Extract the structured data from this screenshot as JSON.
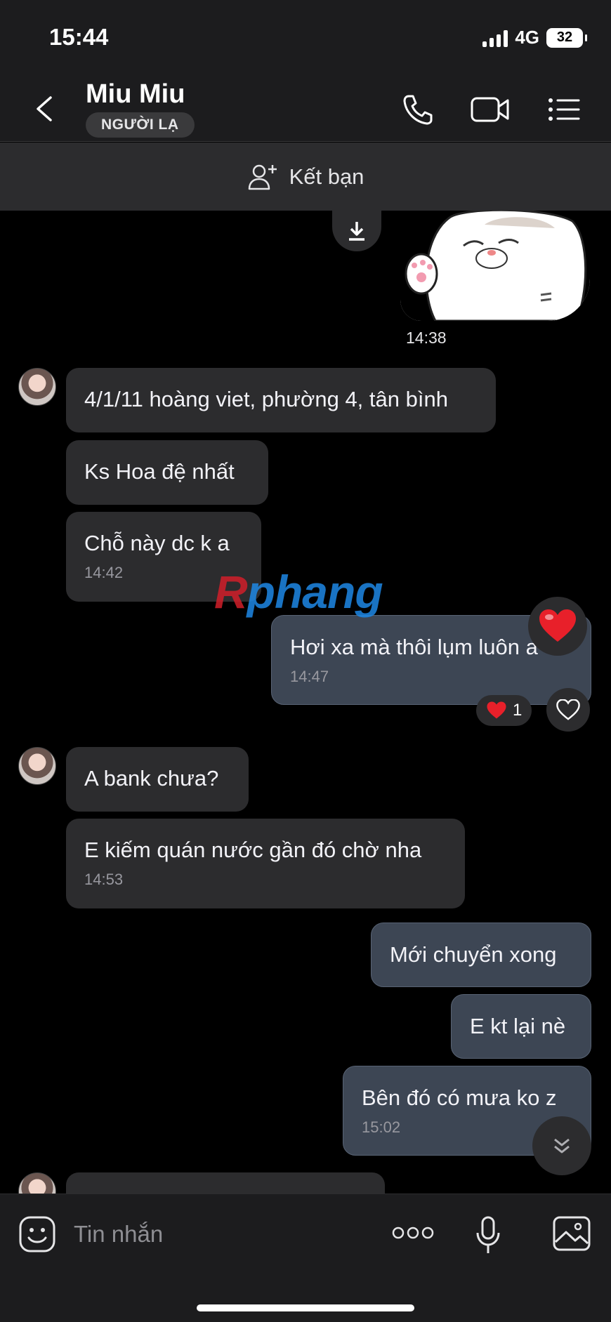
{
  "status": {
    "time": "15:44",
    "network": "4G",
    "battery": "32"
  },
  "header": {
    "name": "Miu Miu",
    "badge": "NGƯỜI LẠ"
  },
  "add_friend": {
    "label": "Kết bạn"
  },
  "messages": {
    "sticker_time": "14:38",
    "m1": "4/1/11 hoàng viet, phường 4, tân bình",
    "m2": "Ks Hoa đệ nhất",
    "m3": "Chỗ này dc k a",
    "m3_time": "14:42",
    "m4": "Hơi xa mà thôi lụm luôn a",
    "m4_time": "14:47",
    "m4_reaction_count": "1",
    "m5": "A bank chưa?",
    "m6": "E kiếm quán nước gần đó chờ nha",
    "m6_time": "14:53",
    "m7": "Mới chuyển xong",
    "m8": "E kt lại nè",
    "m9": "Bên đó có mưa ko z",
    "m9_time": "15:02"
  },
  "watermark": {
    "first": "R",
    "rest": "phang"
  },
  "composer": {
    "placeholder": "Tin nhắn"
  },
  "icons": {
    "back": "chevron-left-icon",
    "call": "phone-icon",
    "video": "video-camera-icon",
    "menu": "list-icon",
    "sticker": "emoji-icon",
    "more": "more-dots-icon",
    "mic": "microphone-icon",
    "gallery": "image-icon"
  },
  "colors": {
    "outgoing_bubble": "#3d4654",
    "incoming_bubble": "#2c2c2e",
    "heart": "#e8202a"
  }
}
